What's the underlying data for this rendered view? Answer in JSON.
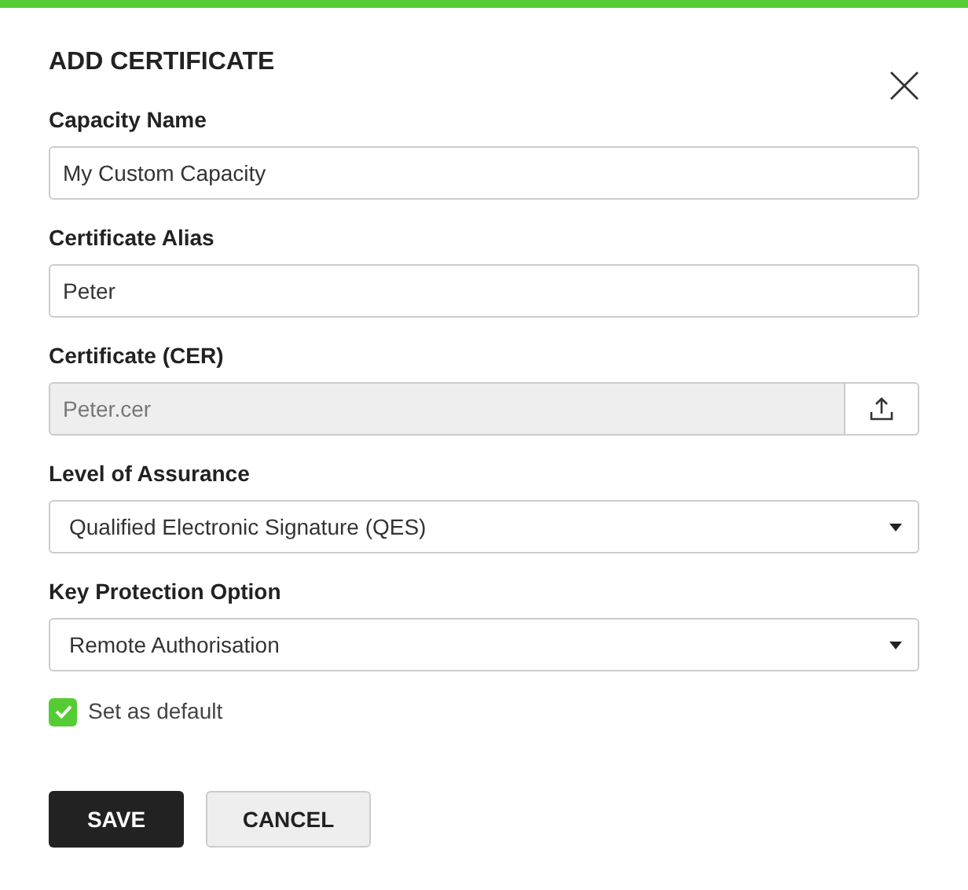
{
  "dialog": {
    "title": "ADD CERTIFICATE"
  },
  "fields": [
    {
      "kind": "text",
      "label": "Capacity Name",
      "value": "My Custom Capacity",
      "disabled": false
    },
    {
      "kind": "text",
      "label": "Certificate Alias",
      "value": "Peter",
      "disabled": false
    },
    {
      "kind": "file",
      "label": "Certificate (CER)",
      "value": "Peter.cer",
      "disabled": true
    },
    {
      "kind": "select",
      "label": "Level of Assurance",
      "value": "Qualified Electronic Signature (QES)",
      "disabled": false
    },
    {
      "kind": "select",
      "label": "Key Protection Option",
      "value": "Remote Authorisation",
      "disabled": false
    }
  ],
  "default_checkbox": {
    "label": "Set as default",
    "checked": true
  },
  "buttons": [
    {
      "kind": "primary",
      "label": "SAVE"
    },
    {
      "kind": "secondary",
      "label": "CANCEL"
    }
  ]
}
